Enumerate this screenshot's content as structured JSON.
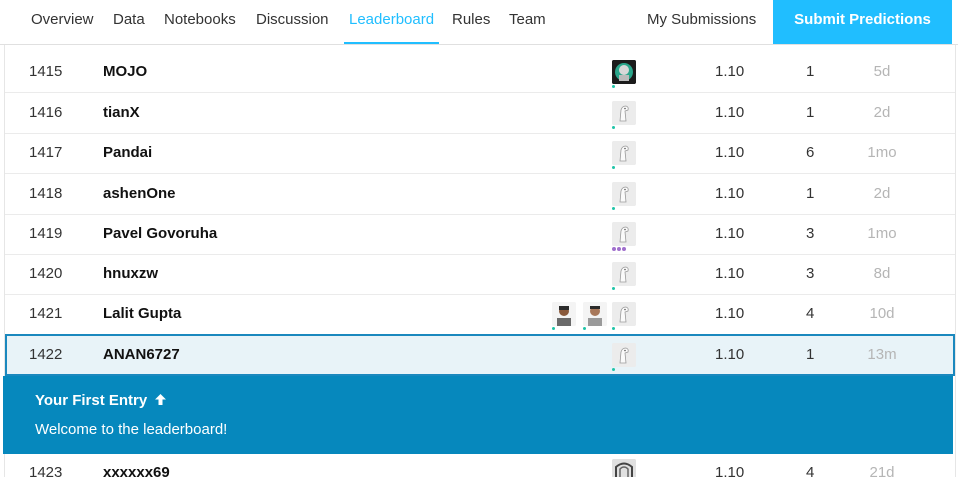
{
  "nav": {
    "tabs": [
      {
        "label": "Overview"
      },
      {
        "label": "Data"
      },
      {
        "label": "Notebooks"
      },
      {
        "label": "Discussion"
      },
      {
        "label": "Leaderboard"
      },
      {
        "label": "Rules"
      },
      {
        "label": "Team"
      }
    ],
    "active_tab": "Leaderboard",
    "my_submissions": "My Submissions",
    "submit_button": "Submit Predictions"
  },
  "leaderboard": {
    "rows": [
      {
        "rank": "1415",
        "team": "MOJO",
        "score": "1.10",
        "entries": "1",
        "last": "5d"
      },
      {
        "rank": "1416",
        "team": "tianX",
        "score": "1.10",
        "entries": "1",
        "last": "2d"
      },
      {
        "rank": "1417",
        "team": "Pandai",
        "score": "1.10",
        "entries": "6",
        "last": "1mo"
      },
      {
        "rank": "1418",
        "team": "ashenOne",
        "score": "1.10",
        "entries": "1",
        "last": "2d"
      },
      {
        "rank": "1419",
        "team": "Pavel Govoruha",
        "score": "1.10",
        "entries": "3",
        "last": "1mo"
      },
      {
        "rank": "1420",
        "team": "hnuxzw",
        "score": "1.10",
        "entries": "3",
        "last": "8d"
      },
      {
        "rank": "1421",
        "team": "Lalit Gupta",
        "score": "1.10",
        "entries": "4",
        "last": "10d"
      },
      {
        "rank": "1422",
        "team": "ANAN6727",
        "score": "1.10",
        "entries": "1",
        "last": "13m"
      },
      {
        "rank": "1423",
        "team": "xxxxxx69",
        "score": "1.10",
        "entries": "4",
        "last": "21d"
      }
    ]
  },
  "banner": {
    "title": "Your First Entry",
    "title_icon": "arrow-up-icon",
    "message": "Welcome to the leaderboard!"
  },
  "colors": {
    "accent": "#20beff",
    "banner": "#0688bd",
    "highlight_row": "#e8f3f8"
  }
}
